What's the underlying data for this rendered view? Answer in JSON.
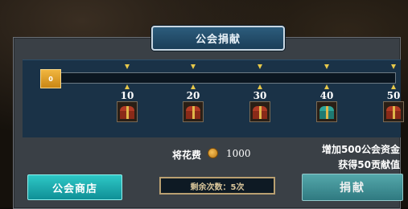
{
  "title": "公会捐献",
  "progress": {
    "start_value": "0",
    "fill_fraction": 0,
    "milestones": [
      {
        "label": "10",
        "chest": "red-chest-icon",
        "colors": {
          "lid": "#b13a25",
          "box": "#8a2a18"
        }
      },
      {
        "label": "20",
        "chest": "red-chest-icon",
        "colors": {
          "lid": "#b13a25",
          "box": "#8a2a18"
        }
      },
      {
        "label": "30",
        "chest": "red-chest-icon",
        "colors": {
          "lid": "#b13a25",
          "box": "#8a2a18"
        }
      },
      {
        "label": "40",
        "chest": "teal-chest-icon",
        "colors": {
          "lid": "#2da59a",
          "box": "#1e7a72"
        }
      },
      {
        "label": "50",
        "chest": "red-chest-icon",
        "colors": {
          "lid": "#b13a25",
          "box": "#8a2a18"
        }
      }
    ]
  },
  "cost": {
    "label": "将花费",
    "icon": "gold-coin-icon",
    "value": "1000"
  },
  "reward": {
    "line1": "增加500公会资金",
    "line2": "获得50贡献值"
  },
  "buttons": {
    "shop": "公会商店",
    "donate": "捐献"
  },
  "remaining": "剩余次数：5次",
  "colors": {
    "accent_gold": "#e8c94a",
    "panel": "#3a4046",
    "inner_panel": "#1a3247",
    "button_teal": "#1fb0b0"
  }
}
